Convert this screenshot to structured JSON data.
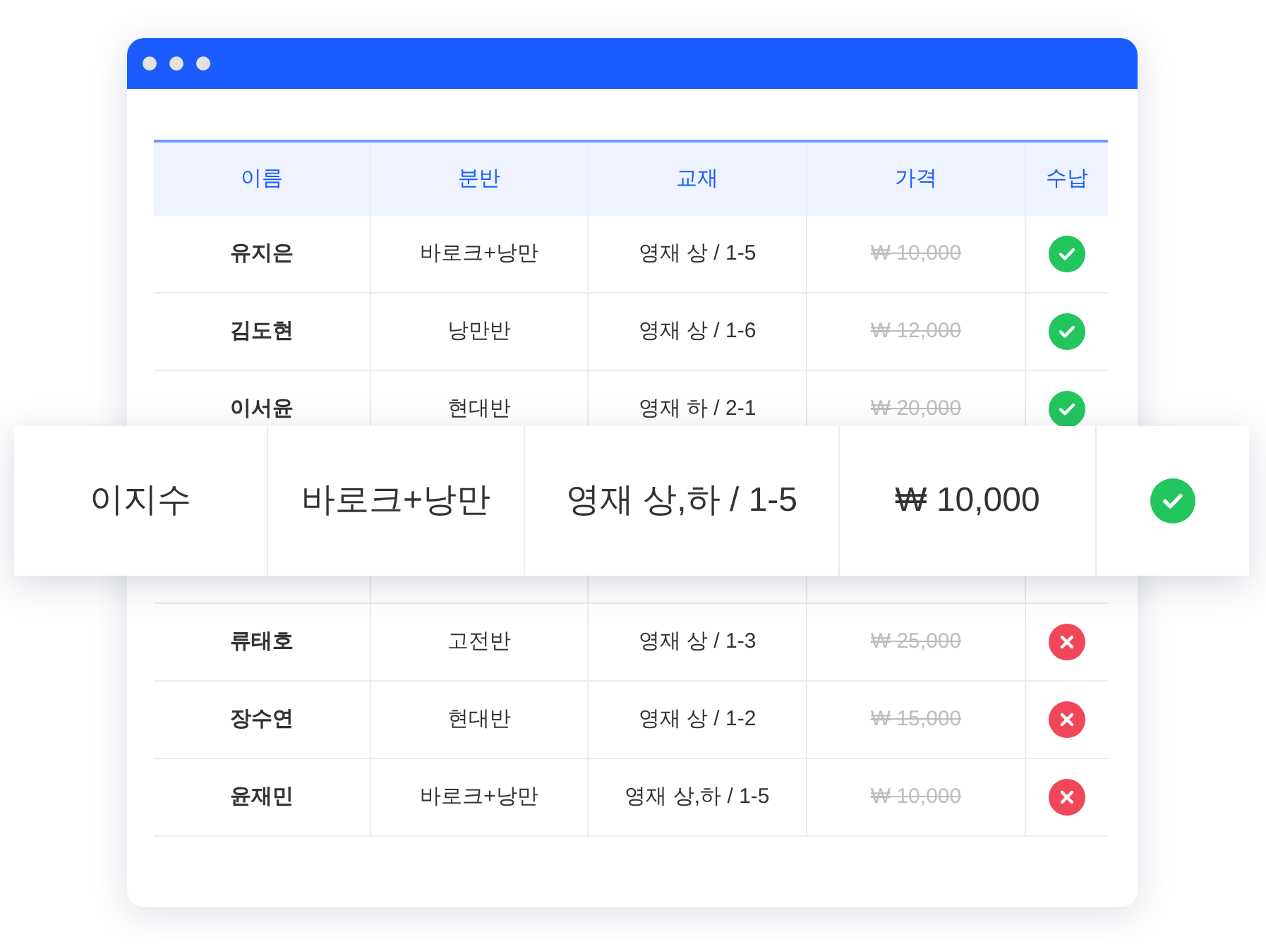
{
  "table": {
    "columns": [
      "이름",
      "분반",
      "교재",
      "가격",
      "수납"
    ],
    "rows": [
      {
        "name": "유지은",
        "class": "바로크+낭만",
        "book": "영재 상 / 1-5",
        "price": "₩ 10,000",
        "struck": true,
        "paid": true
      },
      {
        "name": "김도현",
        "class": "낭만반",
        "book": "영재 상 / 1-6",
        "price": "₩ 12,000",
        "struck": true,
        "paid": true
      },
      {
        "name": "이서윤",
        "class": "현대반",
        "book": "영재 하 / 2-1",
        "price": "₩ 20,000",
        "struck": true,
        "paid": true
      },
      {
        "name": "류태호",
        "class": "고전반",
        "book": "영재 상 / 1-3",
        "price": "₩ 25,000",
        "struck": true,
        "paid": false
      },
      {
        "name": "장수연",
        "class": "현대반",
        "book": "영재 상 / 1-2",
        "price": "₩ 15,000",
        "struck": true,
        "paid": false
      },
      {
        "name": "윤재민",
        "class": "바로크+낭만",
        "book": "영재 상,하 / 1-5",
        "price": "₩ 10,000",
        "struck": true,
        "paid": false
      }
    ]
  },
  "highlight_row": {
    "name": "이지수",
    "class": "바로크+낭만",
    "book": "영재 상,하 / 1-5",
    "price": "₩ 10,000",
    "struck": false,
    "paid": true
  }
}
